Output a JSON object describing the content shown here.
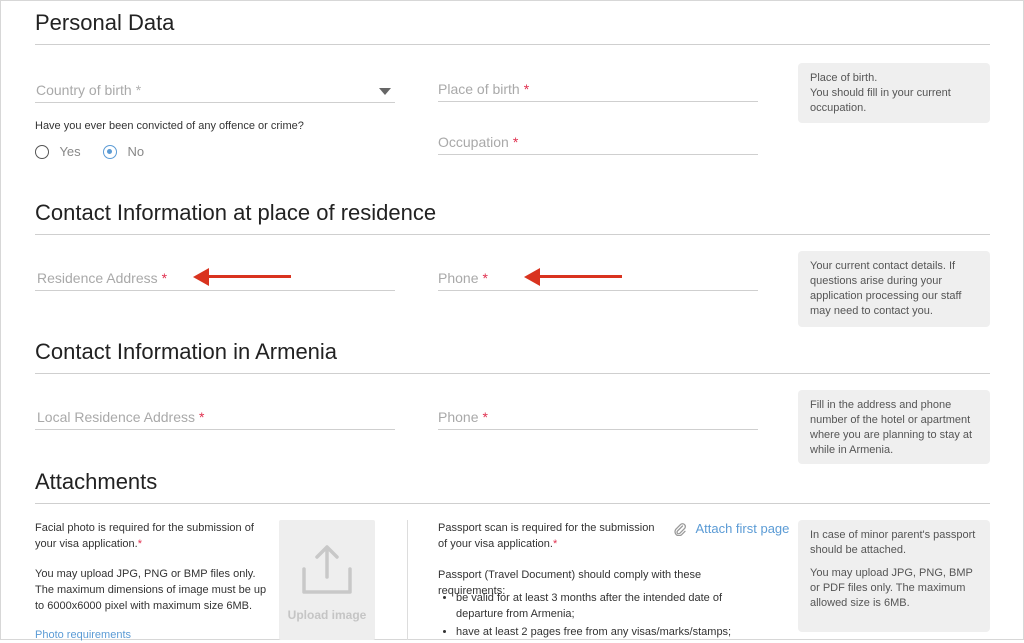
{
  "personal": {
    "title": "Personal Data",
    "country_of_birth": "Country of birth",
    "place_of_birth": "Place of birth",
    "occupation": "Occupation",
    "convicted_question": "Have you ever been convicted of any offence or crime?",
    "yes": "Yes",
    "no": "No",
    "hint_line1": "Place of birth.",
    "hint_line2": "You should fill in your current occupation."
  },
  "residence": {
    "title": "Contact Information at place of residence",
    "address": "Residence Address",
    "phone": "Phone",
    "hint": "Your current contact details. If questions arise during your application processing our staff may need to contact you."
  },
  "armenia": {
    "title": "Contact Information in Armenia",
    "address": "Local Residence Address",
    "phone": "Phone",
    "hint": "Fill in the address and phone number of the hotel or apartment where you are planning to stay at while in Armenia."
  },
  "attachments": {
    "title": "Attachments",
    "photo_required": "Facial photo is required for the submission of your visa application.",
    "photo_formats": "You may upload JPG, PNG or BMP files only. The maximum dimensions of image must be up to 6000x6000 pixel with maximum size 6MB.",
    "photo_requirements_link": "Photo requirements",
    "upload_image": "Upload image",
    "passport_required": "Passport scan is required for the submission of your visa application.",
    "attach_first_page": "Attach first page",
    "passport_comply": "Passport (Travel Document) should comply with these requirements:",
    "passport_reqs": [
      "be valid for at least 3 months after the intended date of departure from Armenia;",
      "have at least 2 pages free from any visas/marks/stamps;"
    ],
    "hint_line1": "In case of minor parent's passport should be attached.",
    "hint_line2": "You may upload JPG, PNG, BMP or PDF files only. The maximum allowed size is 6MB."
  },
  "required_mark": "*",
  "colors": {
    "accent": "#5b9bd5",
    "required": "#e0304f",
    "arrow": "#d9331f"
  }
}
